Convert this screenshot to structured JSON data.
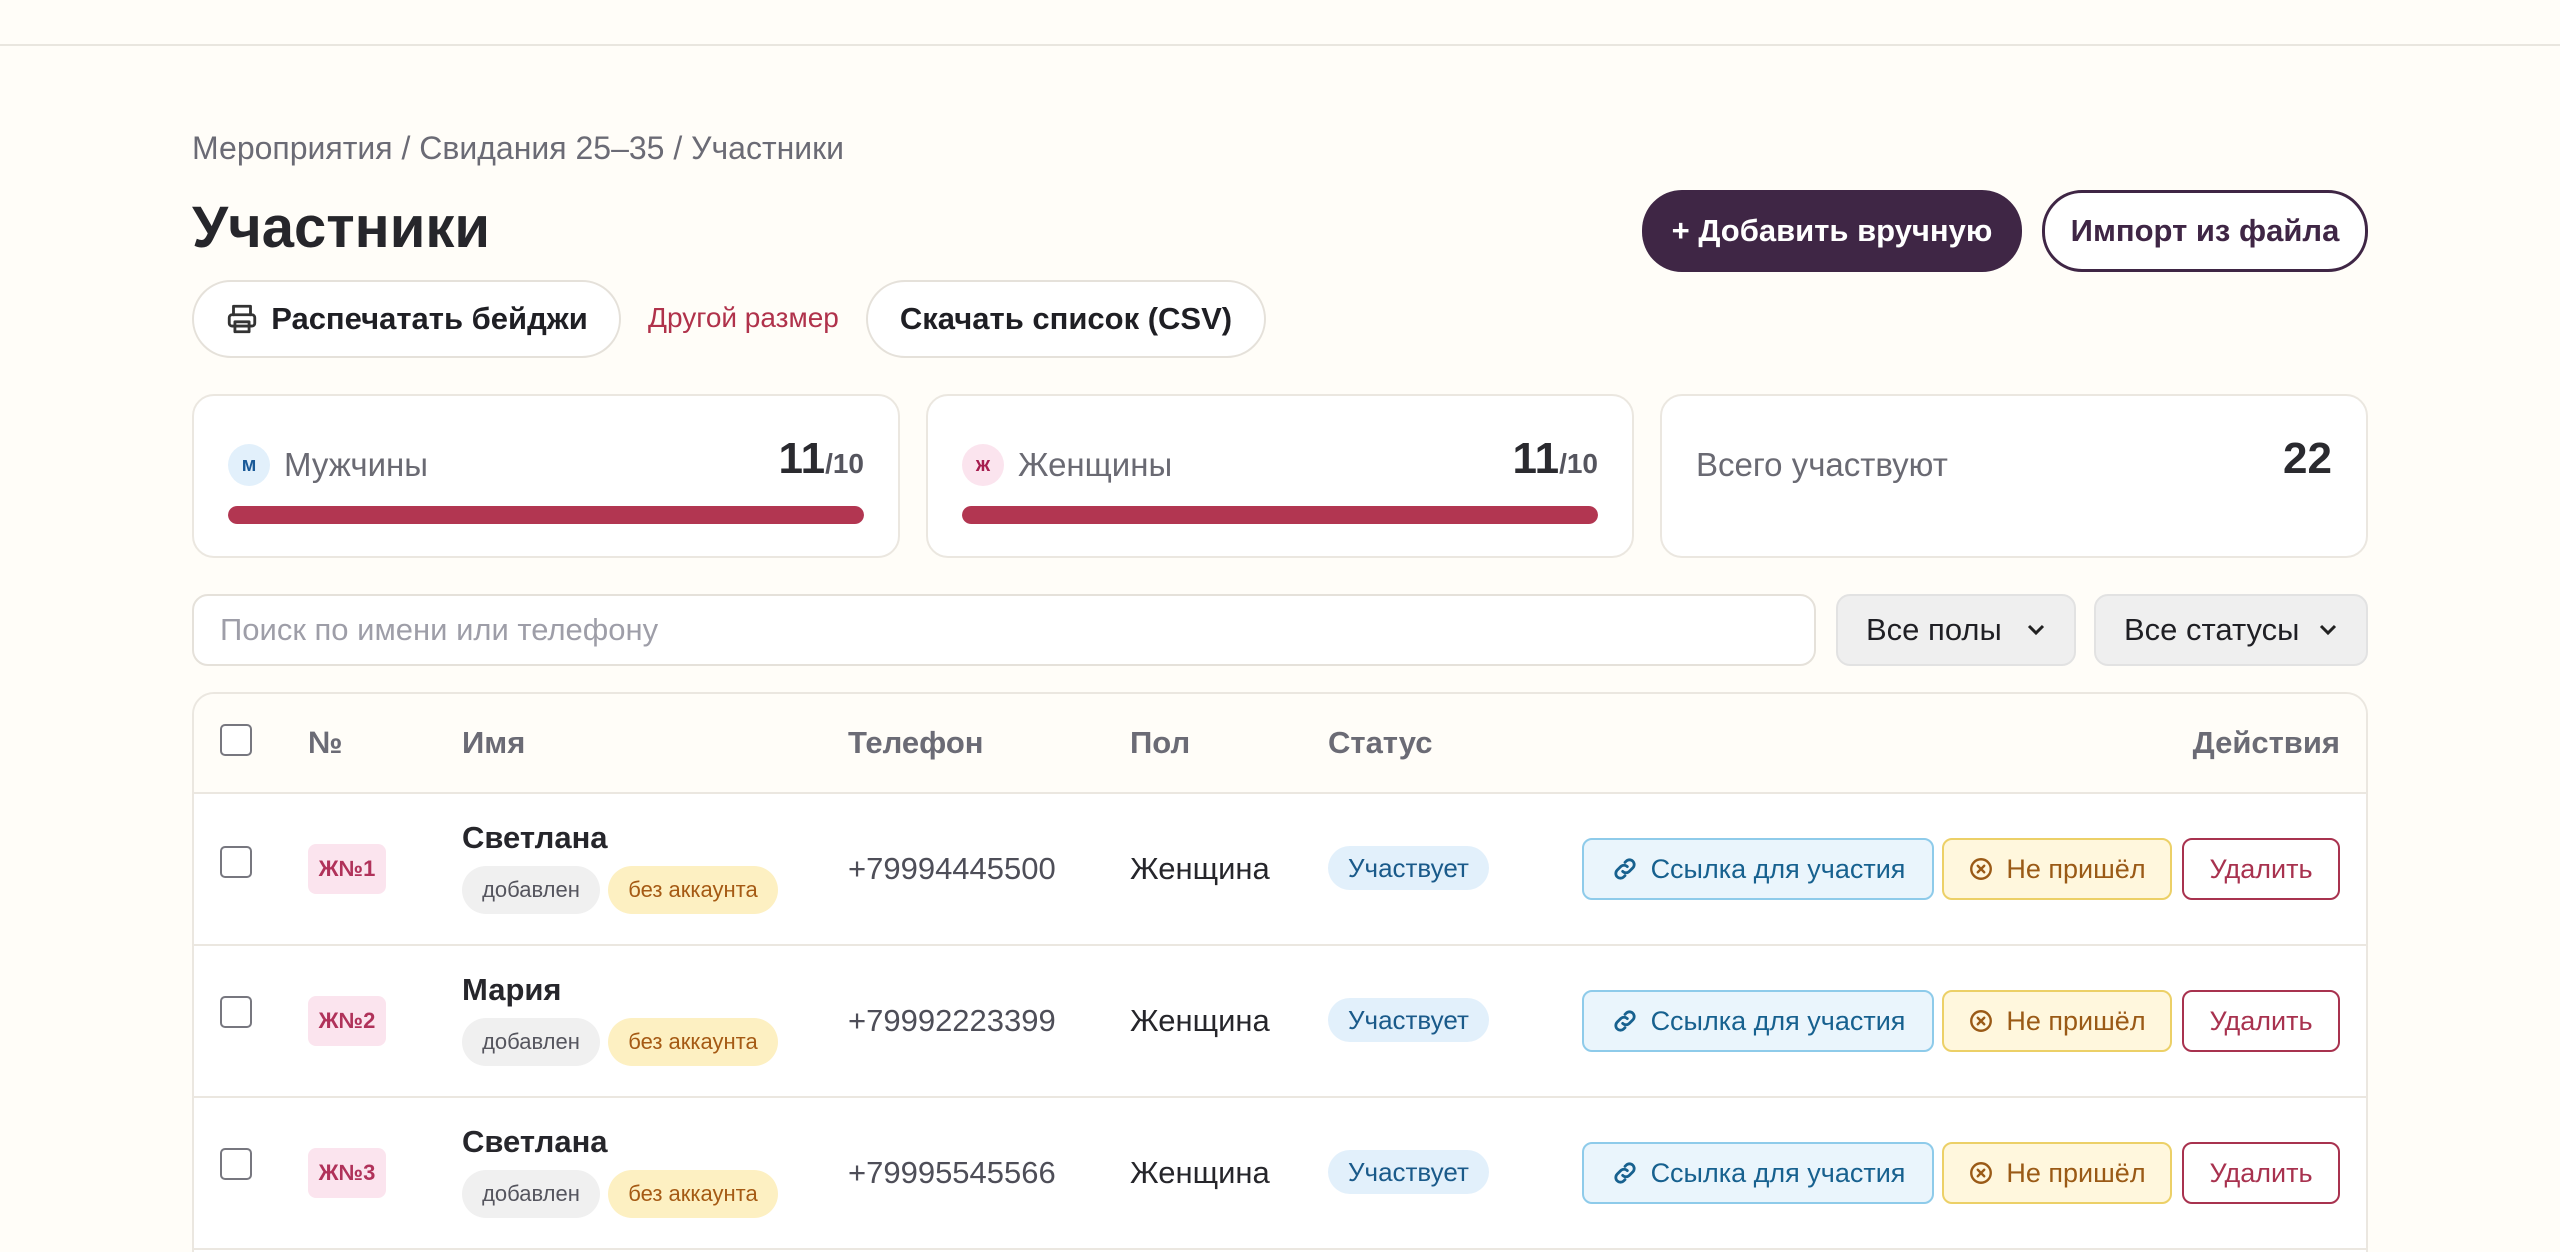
{
  "breadcrumb": "Мероприятия / Свидания 25–35 / Участники",
  "title": "Участники",
  "header_actions": {
    "add_manual": "+ Добавить вручную",
    "import_file": "Импорт из файла"
  },
  "toolbar": {
    "print_badges": "Распечатать бейджи",
    "other_size": "Другой размер",
    "download_csv": "Скачать список (CSV)"
  },
  "stats": {
    "men": {
      "badge": "м",
      "label": "Мужчины",
      "count": "11",
      "max": "/10",
      "fill_percent": 100
    },
    "women": {
      "badge": "ж",
      "label": "Женщины",
      "count": "11",
      "max": "/10",
      "fill_percent": 100
    },
    "total": {
      "label": "Всего участвуют",
      "count": "22"
    }
  },
  "filters": {
    "search_placeholder": "Поиск по имени или телефону",
    "gender_select": "Все полы",
    "status_select": "Все статусы"
  },
  "table": {
    "columns": {
      "number": "№",
      "name": "Имя",
      "phone": "Телефон",
      "gender": "Пол",
      "status": "Статус",
      "actions": "Действия"
    },
    "rows": [
      {
        "badge": "Ж№1",
        "name": "Светлана",
        "tag_added": "добавлен",
        "tag_account": "без аккаунта",
        "phone": "+79994445500",
        "gender": "Женщина",
        "status": "Участвует",
        "link": "Ссылка для участия",
        "noshow": "Не пришёл",
        "delete": "Удалить"
      },
      {
        "badge": "Ж№2",
        "name": "Мария",
        "tag_added": "добавлен",
        "tag_account": "без аккаунта",
        "phone": "+79992223399",
        "gender": "Женщина",
        "status": "Участвует",
        "link": "Ссылка для участия",
        "noshow": "Не пришёл",
        "delete": "Удалить"
      },
      {
        "badge": "Ж№3",
        "name": "Светлана",
        "tag_added": "добавлен",
        "tag_account": "без аккаунта",
        "phone": "+79995545566",
        "gender": "Женщина",
        "status": "Участвует",
        "link": "Ссылка для участия",
        "noshow": "Не пришёл",
        "delete": "Удалить"
      }
    ]
  },
  "colors": {
    "primary": "#3f2645",
    "accent_red": "#b23651",
    "status_blue": "#e2f0fb",
    "warning_yellow": "#fff7dd",
    "background": "#fffdf8"
  },
  "icons": {
    "print": "printer-icon",
    "link": "link-icon",
    "noshow": "x-circle-icon",
    "select": "chevron-down-icon"
  }
}
